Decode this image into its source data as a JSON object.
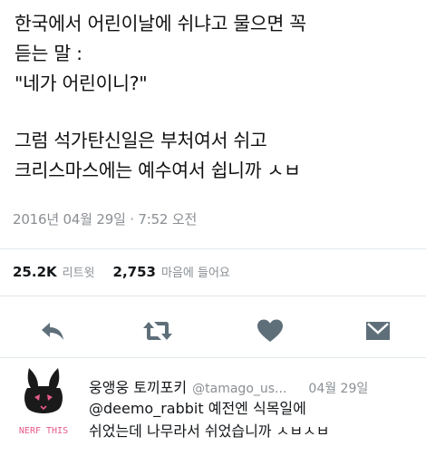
{
  "tweet": {
    "lines_block1": [
      "한국에서 어린이날에 쉬냐고 물으면 꼭",
      "듣는 말 :",
      "\"네가 어린이니?\""
    ],
    "lines_block2": [
      "그럼 석가탄신일은 부처여서 쉬고",
      "크리스마스에는 예수여서 쉽니까 ㅅㅂ"
    ],
    "timestamp": "2016년 04월 29일 · 7:52 오전"
  },
  "stats": {
    "retweets_count": "25.2K",
    "retweets_label": "리트윗",
    "likes_count": "2,753",
    "likes_label": "마음에 들어요"
  },
  "actions": {
    "reply_icon": "reply-icon",
    "retweet_icon": "retweet-icon",
    "like_icon": "heart-icon",
    "dm_icon": "envelope-icon",
    "icon_color": "#5f6f7a"
  },
  "reply": {
    "avatar_caption": "NERF THIS",
    "name": "웅앵웅 토끼포키",
    "handle": "@tamago_us...",
    "date": "04월 29일",
    "line1_mention": "@deemo_rabbit",
    "line1_rest": " 예전엔 식목일에",
    "line2": "쉬었는데 나무라서 쉬었습니까 ㅅㅂㅅㅂ"
  },
  "colors": {
    "text": "#111111",
    "muted": "#8a8f94",
    "divider": "#e1e8ed",
    "avatar_pink": "#e85a8a"
  }
}
